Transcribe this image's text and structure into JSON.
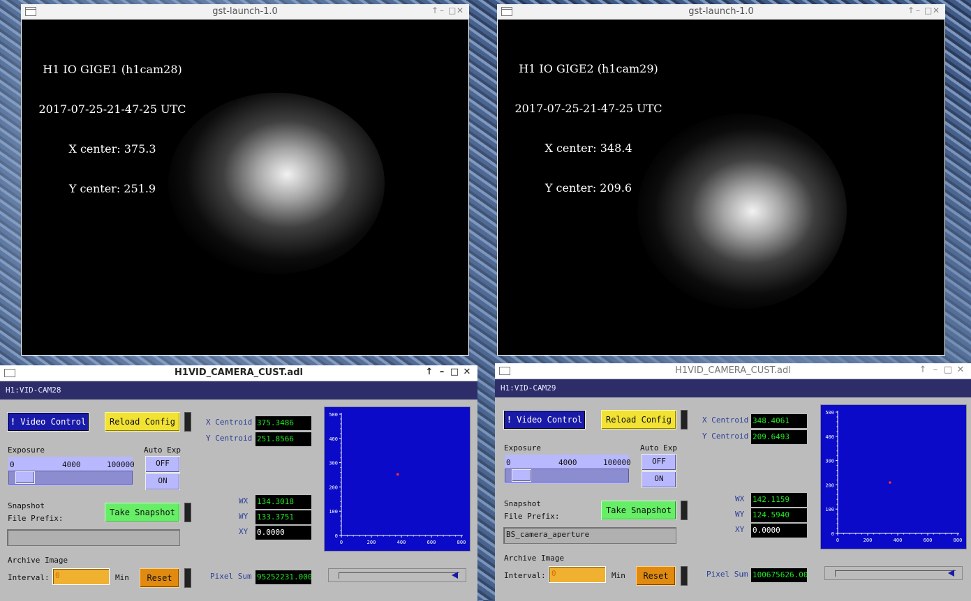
{
  "top_windows": [
    {
      "title": "gst-launch-1.0",
      "overlay": [
        "H1 IO GIGE1 (h1cam28)",
        "2017-07-25-21-47-25 UTC",
        "X center: 375.3",
        "Y center: 251.9"
      ]
    },
    {
      "title": "gst-launch-1.0",
      "overlay": [
        "H1 IO GIGE2 (h1cam29)",
        "2017-07-25-21-47-25 UTC",
        "X center: 348.4",
        "Y center: 209.6"
      ]
    }
  ],
  "panels": [
    {
      "title": "H1VID_CAMERA_CUST.adl",
      "pv": "H1:VID-CAM28",
      "video_control": "Video Control",
      "reload_config": "Reload Config",
      "x_centroid_label": "X Centroid",
      "x_centroid": "375.3486",
      "y_centroid_label": "Y Centroid",
      "y_centroid": "251.8566",
      "exposure_label": "Exposure",
      "scale": [
        "0",
        "4000",
        "100000"
      ],
      "auto_exp_label": "Auto Exp",
      "off": "OFF",
      "on": "ON",
      "wx_label": "WX",
      "wx": "134.3018",
      "wy_label": "WY",
      "wy": "133.3751",
      "xy_label": "XY",
      "xy": "0.0000",
      "snapshot_label": "Snapshot",
      "file_prefix_label": "File Prefix:",
      "file_prefix": "",
      "take_snapshot": "Take Snapshot",
      "archive_label": "Archive Image",
      "interval_label": "Interval:",
      "interval": "0",
      "min_label": "Min",
      "reset": "Reset",
      "pixel_sum_label": "Pixel Sum",
      "pixel_sum": "95252231.000",
      "plot": {
        "y_ticks": [
          "500",
          "400",
          "300",
          "200",
          "100",
          "0"
        ],
        "x_ticks": [
          "0",
          "200",
          "400",
          "600",
          "800"
        ],
        "point": {
          "x": 375.3,
          "y": 251.9
        }
      }
    },
    {
      "title": "H1VID_CAMERA_CUST.adl",
      "pv": "H1:VID-CAM29",
      "video_control": "Video Control",
      "reload_config": "Reload Config",
      "x_centroid_label": "X Centroid",
      "x_centroid": "348.4061",
      "y_centroid_label": "Y Centroid",
      "y_centroid": "209.6493",
      "exposure_label": "Exposure",
      "scale": [
        "0",
        "4000",
        "100000"
      ],
      "auto_exp_label": "Auto Exp",
      "off": "OFF",
      "on": "ON",
      "wx_label": "WX",
      "wx": "142.1159",
      "wy_label": "WY",
      "wy": "124.5940",
      "xy_label": "XY",
      "xy": "0.0000",
      "snapshot_label": "Snapshot",
      "file_prefix_label": "File Prefix:",
      "file_prefix": "BS_camera_aperture",
      "take_snapshot": "Take Snapshot",
      "archive_label": "Archive Image",
      "interval_label": "Interval:",
      "interval": "0",
      "min_label": "Min",
      "reset": "Reset",
      "pixel_sum_label": "Pixel Sum",
      "pixel_sum": "100675626.000",
      "plot": {
        "y_ticks": [
          "500",
          "400",
          "300",
          "200",
          "100",
          "0"
        ],
        "x_ticks": [
          "0",
          "200",
          "400",
          "600",
          "800"
        ],
        "point": {
          "x": 348.4,
          "y": 209.6
        }
      }
    }
  ],
  "colors": {
    "pv_bar": "#2d2d6a",
    "plot_bg": "#0a0ac8",
    "readout_text": "#22e622",
    "panel_bg": "#bcbcbc"
  }
}
